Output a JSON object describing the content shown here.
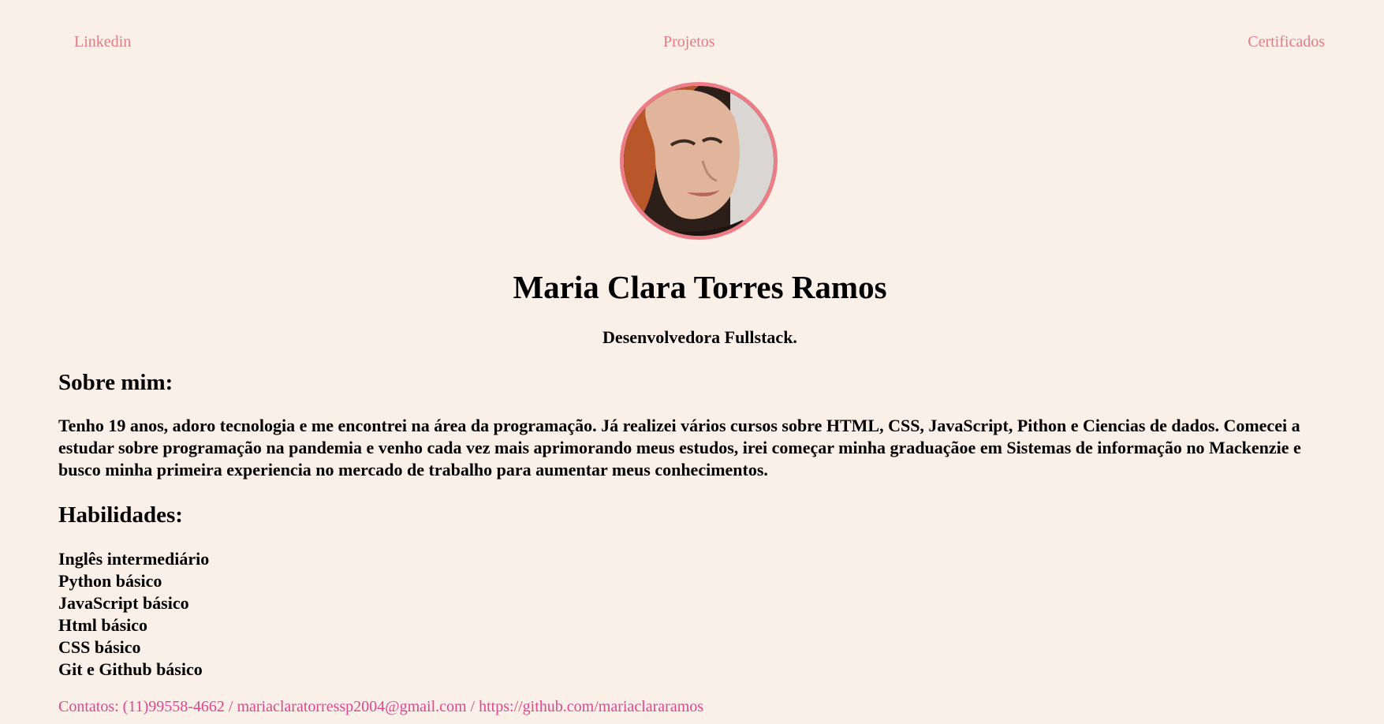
{
  "nav": {
    "linkedin": "Linkedin",
    "projetos": "Projetos",
    "certificados": "Certificados"
  },
  "profile": {
    "name": "Maria Clara Torres Ramos",
    "role": "Desenvolvedora Fullstack."
  },
  "about": {
    "title": "Sobre mim:",
    "text": "Tenho 19 anos, adoro tecnologia e me encontrei na área da programação. Já realizei vários cursos sobre HTML, CSS, JavaScript, Pithon e Ciencias de dados. Comecei a estudar sobre programação na pandemia e venho cada vez mais aprimorando meus estudos, irei começar minha graduaçãoe em Sistemas de informação no Mackenzie e busco minha primeira experiencia no mercado de trabalho para aumentar meus conhecimentos."
  },
  "skills": {
    "title": "Habilidades:",
    "items": [
      "Inglês intermediário",
      "Python básico",
      "JavaScript básico",
      "Html básico",
      "CSS básico",
      "Git e Github básico"
    ]
  },
  "contacts": {
    "text": "Contatos: (11)99558-4662 / mariaclaratorressp2004@gmail.com / https://github.com/mariaclararamos"
  },
  "colors": {
    "background": "#faf0e8",
    "nav_link": "#e47c86",
    "avatar_border": "#ec7c86",
    "contacts": "#e0468e"
  }
}
